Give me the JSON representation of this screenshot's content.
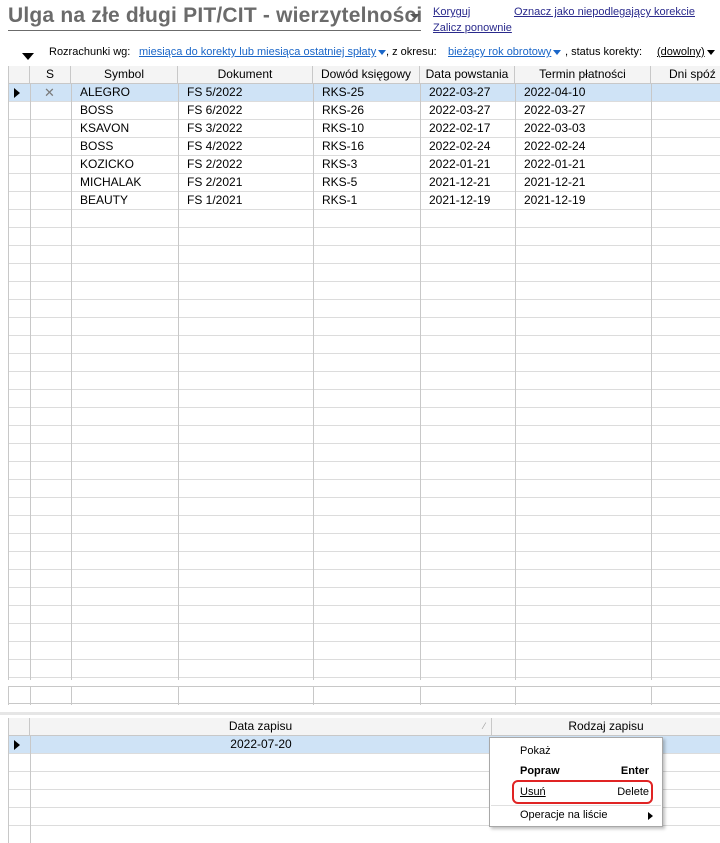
{
  "title": "Ulga na złe długi PIT/CIT - wierzytelności",
  "header_links": {
    "koryguj": "Koryguj",
    "zalicz": "Zalicz ponownie",
    "oznacz": "Oznacz jako niepodlegający korekcie"
  },
  "filters": {
    "rozrachunki_label": "Rozrachunki wg:",
    "rozrachunki_value": "miesiąca do korekty lub miesiąca ostatniej spłaty",
    "okres_label": ", z okresu:",
    "okres_value": "bieżący rok obrotowy",
    "status_label": ", status korekty:",
    "status_value": "(dowolny)"
  },
  "table": {
    "columns": [
      "S",
      "Symbol",
      "Dokument",
      "Dowód księgowy",
      "Data powstania",
      "Termin płatności",
      "Dni spóź"
    ],
    "rows": [
      {
        "s": "✕",
        "symbol": "ALEGRO",
        "dokument": "FS 5/2022",
        "dowod": "RKS-25",
        "data": "2022-03-27",
        "termin": "2022-04-10"
      },
      {
        "s": "",
        "symbol": "BOSS",
        "dokument": "FS 6/2022",
        "dowod": "RKS-26",
        "data": "2022-03-27",
        "termin": "2022-03-27"
      },
      {
        "s": "",
        "symbol": "KSAVON",
        "dokument": "FS 3/2022",
        "dowod": "RKS-10",
        "data": "2022-02-17",
        "termin": "2022-03-03"
      },
      {
        "s": "",
        "symbol": "BOSS",
        "dokument": "FS 4/2022",
        "dowod": "RKS-16",
        "data": "2022-02-24",
        "termin": "2022-02-24"
      },
      {
        "s": "",
        "symbol": "KOZICKO",
        "dokument": "FS 2/2022",
        "dowod": "RKS-3",
        "data": "2022-01-21",
        "termin": "2022-01-21"
      },
      {
        "s": "",
        "symbol": "MICHALAK",
        "dokument": "FS 2/2021",
        "dowod": "RKS-5",
        "data": "2021-12-21",
        "termin": "2021-12-21"
      },
      {
        "s": "",
        "symbol": "BEAUTY",
        "dokument": "FS 1/2021",
        "dowod": "RKS-1",
        "data": "2021-12-19",
        "termin": "2021-12-19"
      }
    ]
  },
  "sub_table": {
    "columns": [
      "Data zapisu",
      "Rodzaj zapisu"
    ],
    "rows": [
      {
        "data_zapisu": "2022-07-20",
        "rodzaj": ""
      }
    ]
  },
  "context_menu": {
    "items": [
      {
        "label": "Pokaż",
        "shortcut": ""
      },
      {
        "label": "Popraw",
        "shortcut": "Enter"
      },
      {
        "label": "Usuń",
        "shortcut": "Delete"
      },
      {
        "label": "Operacje na liście",
        "shortcut": ""
      }
    ]
  }
}
